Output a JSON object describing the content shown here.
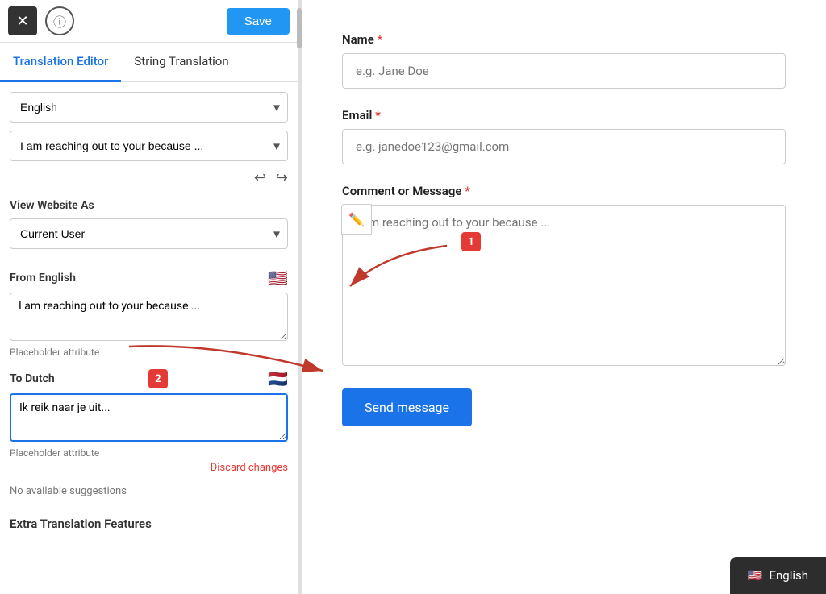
{
  "topbar": {
    "close_label": "✕",
    "info_label": "ⓘ",
    "save_label": "Save"
  },
  "tabs": {
    "tab1": "Translation Editor",
    "tab2": "String Translation"
  },
  "language_dropdown": {
    "selected": "English",
    "placeholder": "English"
  },
  "string_dropdown": {
    "selected": "I am reaching out to your because ...",
    "placeholder": "I am reaching out to your because ..."
  },
  "view_website_as": {
    "label": "View Website As",
    "selected": "Current User"
  },
  "from_section": {
    "title": "From English",
    "value": "I am reaching out to your because ...",
    "attr_label": "Placeholder attribute"
  },
  "to_section": {
    "title": "To Dutch",
    "value": "Ik reik naar je uit...",
    "attr_label": "Placeholder attribute",
    "discard": "Discard changes"
  },
  "suggestions": {
    "none": "No available suggestions"
  },
  "extra": {
    "title": "Extra Translation Features"
  },
  "form": {
    "name_label": "Name",
    "name_placeholder": "e.g. Jane Doe",
    "email_label": "Email",
    "email_placeholder": "e.g. janedoe123@gmail.com",
    "message_label": "Comment or Message",
    "message_placeholder": "I am reaching out to your because ...",
    "send_label": "Send message"
  },
  "lang_badge": {
    "flag": "🇺🇸",
    "label": "English"
  },
  "annotations": {
    "step1": "1",
    "step2": "2"
  }
}
